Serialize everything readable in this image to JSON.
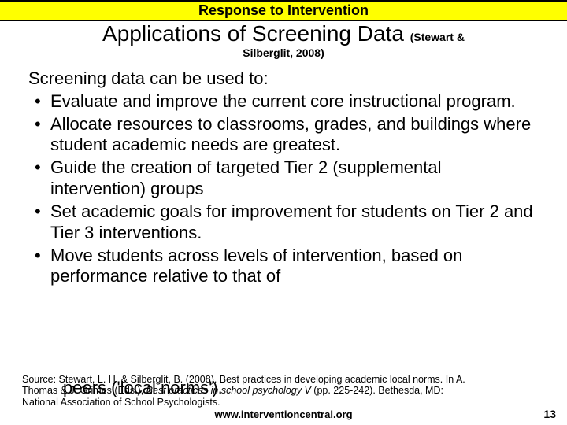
{
  "header": {
    "banner": "Response to Intervention"
  },
  "title": {
    "main": "Applications of Screening Data ",
    "cite_inline": "(Stewart &",
    "cite_line2": "Silberglit, 2008)"
  },
  "content": {
    "intro": "Screening data can be used to:",
    "bullets": [
      "Evaluate and improve the current core instructional program.",
      "Allocate resources to classrooms, grades, and buildings where student academic needs are greatest.",
      "Guide the creation of targeted Tier 2 (supplemental intervention) groups",
      "Set academic goals for improvement for students on Tier 2 and Tier 3 interventions.",
      "Move students across levels of intervention, based on performance relative to that of"
    ],
    "overlap_fragment": "peers ('local norms')."
  },
  "source": {
    "line1a": "Source: Stewart, L. H. & Silberglit, B. (2008). Best practices in developing academic local norms. In A.",
    "line2a": "Thomas & J. Grimes (Eds.), ",
    "line2b": "Best practices in school psychology V ",
    "line2c": "(pp. 225-242). Bethesda, MD:",
    "line3": "National Association of School Psychologists."
  },
  "footer": {
    "url": "www.interventioncentral.org",
    "page": "13"
  }
}
